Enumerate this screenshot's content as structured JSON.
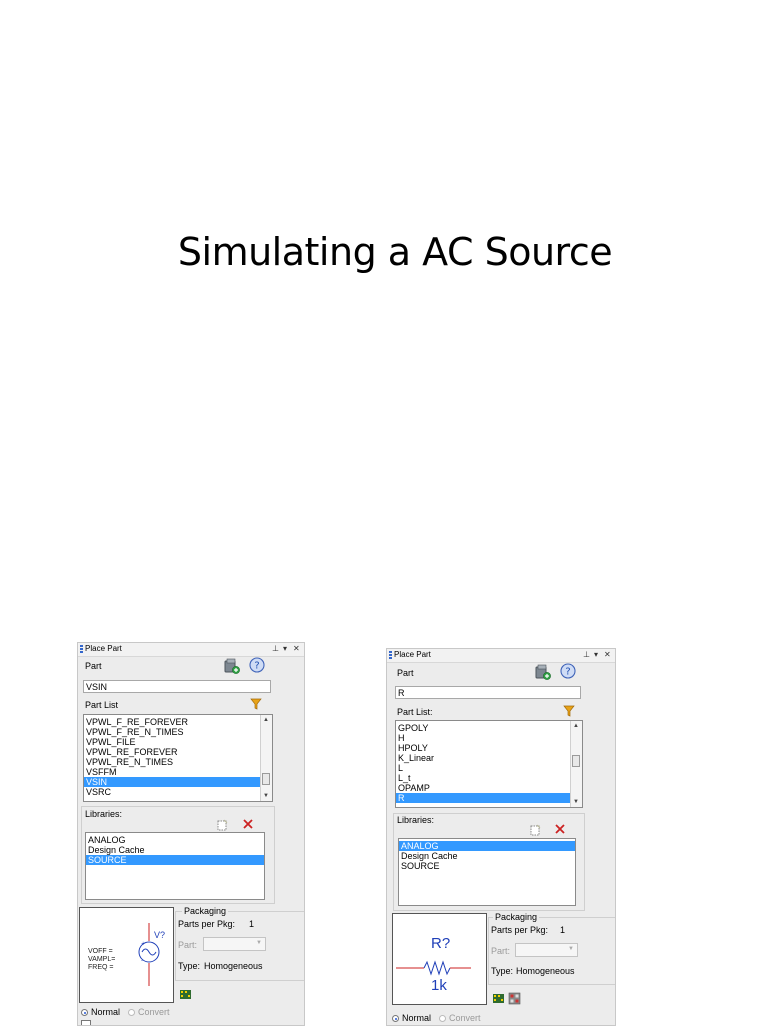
{
  "slide": {
    "title": "Simulating a AC Source"
  },
  "panels": [
    {
      "title": "Place Part",
      "part_label": "Part",
      "part_value": "VSIN",
      "partlist_label": "Part List",
      "partlist_items": [
        "VPWL_F_RE_FOREVER",
        "VPWL_F_RE_N_TIMES",
        "VPWL_FILE",
        "VPWL_RE_FOREVER",
        "VPWL_RE_N_TIMES",
        "VSFFM",
        "VSIN",
        "VSRC"
      ],
      "partlist_selected": 6,
      "libraries_label": "Libraries:",
      "libraries": [
        "ANALOG",
        "Design Cache",
        "SOURCE"
      ],
      "library_selected": 2,
      "packaging_label": "Packaging",
      "parts_per_pkg_label": "Parts per Pkg:",
      "parts_per_pkg_value": "1",
      "part_field_label": "Part:",
      "type_label": "Type:",
      "type_value": "Homogeneous",
      "preview": {
        "refdes": "V?",
        "props": [
          "VOFF =",
          "VAMPL=",
          "FREQ ="
        ]
      },
      "normal_label": "Normal",
      "convert_label": "Convert"
    },
    {
      "title": "Place Part",
      "part_label": "Part",
      "part_value": "R",
      "partlist_label": "Part List:",
      "partlist_items": [
        "GPOLY",
        "H",
        "HPOLY",
        "K_Linear",
        "L",
        "L_t",
        "OPAMP",
        "R"
      ],
      "partlist_selected": 7,
      "libraries_label": "Libraries:",
      "libraries": [
        "ANALOG",
        "Design Cache",
        "SOURCE"
      ],
      "library_selected": 0,
      "packaging_label": "Packaging",
      "parts_per_pkg_label": "Parts per Pkg:",
      "parts_per_pkg_value": "1",
      "part_field_label": "Part:",
      "type_label": "Type:",
      "type_value": "Homogeneous",
      "preview": {
        "refdes": "R?",
        "value": "1k"
      },
      "normal_label": "Normal",
      "convert_label": "Convert"
    }
  ],
  "colors": {
    "selection": "#3399ff",
    "filter": "#e8a317",
    "delete": "#cc2222",
    "symbol": "#1f3fb8",
    "wire": "#cc2222"
  }
}
